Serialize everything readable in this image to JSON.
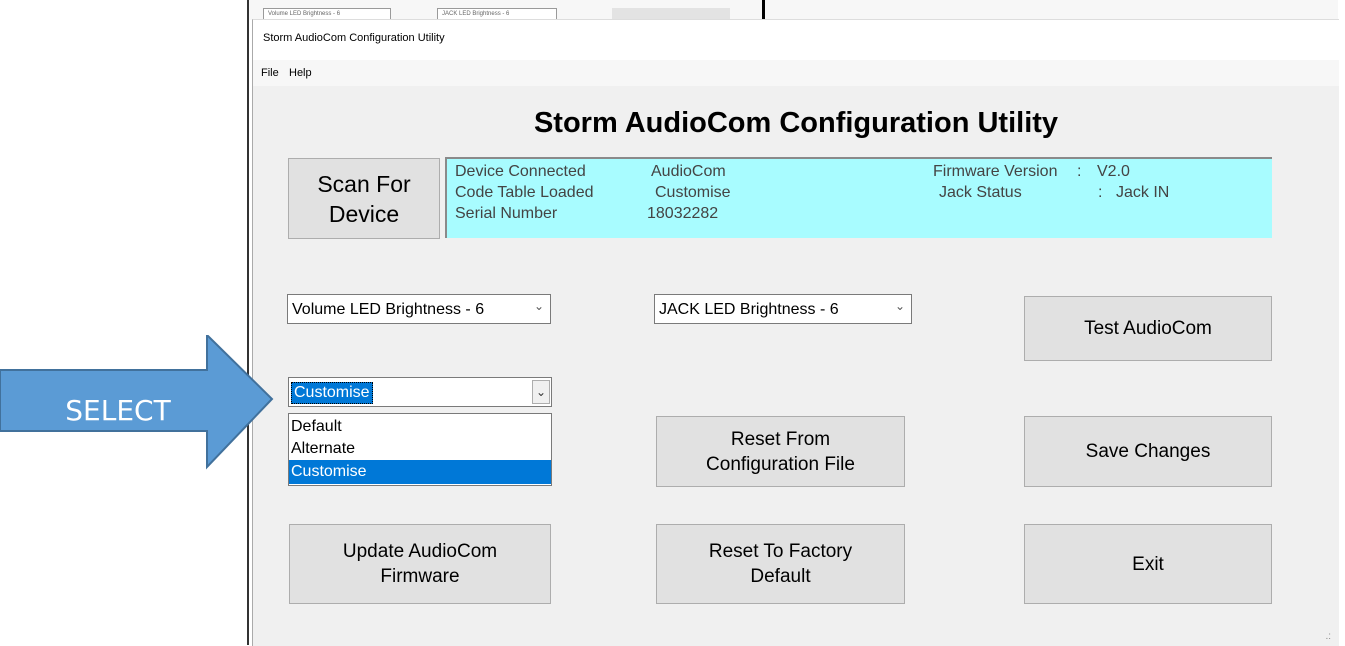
{
  "background": {
    "tabs": [
      "Volume LED Brightness - 6",
      "JACK LED Brightness - 6"
    ]
  },
  "window": {
    "title": "Storm AudioCom  Configuration Utility"
  },
  "menu": {
    "items": [
      "File",
      "Help"
    ]
  },
  "app_title": "Storm AudioCom  Configuration Utility",
  "scan_button": "Scan For\nDevice",
  "device_info": {
    "device_connected_label": "Device Connected",
    "device_connected_value": "AudioCom",
    "code_table_label": "Code Table Loaded",
    "code_table_value": "Customise",
    "serial_label": "Serial Number",
    "serial_value": "18032282",
    "firmware_label": "Firmware Version",
    "firmware_sep": ":",
    "firmware_value": "V2.0",
    "jack_label": "Jack Status",
    "jack_sep": ":",
    "jack_value": "Jack  IN",
    "background_color": "#a8fcff"
  },
  "combos": {
    "volume_led": "Volume LED Brightness - 6",
    "jack_led": "JACK LED Brightness - 6"
  },
  "code_table_select": {
    "selected": "Customise",
    "options": [
      "Default",
      "Alternate",
      "Customise"
    ],
    "highlighted_option": "Customise"
  },
  "buttons": {
    "test": "Test AudioCom",
    "reset_config": "Reset From\nConfiguration File",
    "save": "Save Changes",
    "update_firmware": "Update AudioCom\nFirmware",
    "reset_factory": "Reset To Factory\nDefault",
    "exit": "Exit"
  },
  "annotation": {
    "label": "SELECT",
    "color": "#5b9bd5"
  }
}
